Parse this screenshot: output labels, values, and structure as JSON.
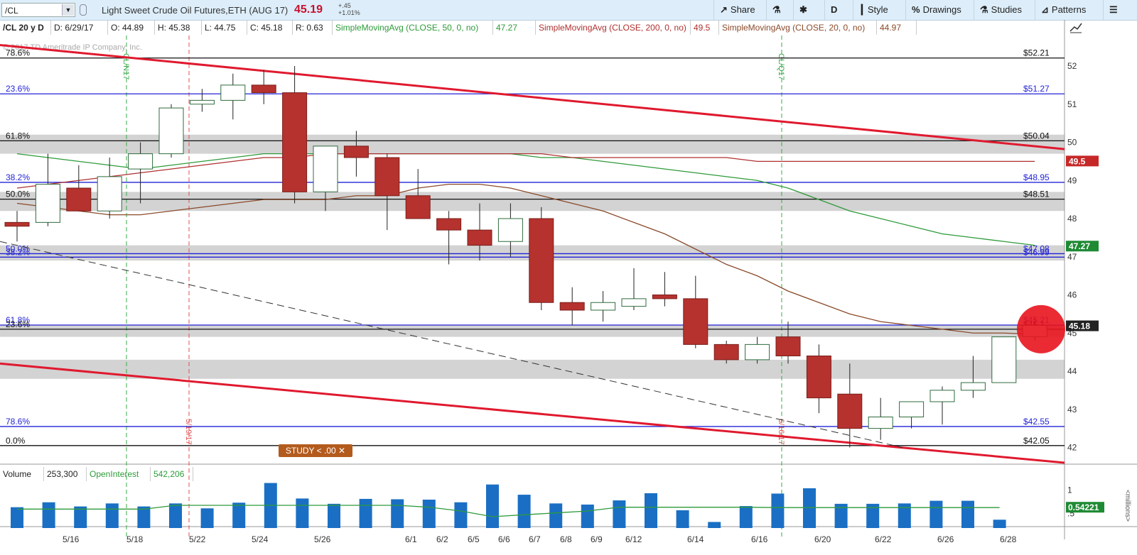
{
  "toolbar": {
    "symbol": "/CL",
    "title": "Light Sweet Crude Oil Futures,ETH (AUG 17)",
    "last": "45.19",
    "change": "+.45",
    "change_pct": "+1.01%",
    "buttons": {
      "share": "Share",
      "aggregation": "D",
      "style": "Style",
      "drawings": "Drawings",
      "studies": "Studies",
      "patterns": "Patterns"
    }
  },
  "info": {
    "symbol_period": "/CL 20 y D",
    "date": "D: 6/29/17",
    "open": "O: 44.89",
    "high": "H: 45.38",
    "low": "L: 44.75",
    "close": "C: 45.18",
    "range": "R: 0.63",
    "sma50_label": "SimpleMovingAvg (CLOSE, 50, 0, no)",
    "sma50_value": "47.27",
    "sma200_label": "SimpleMovingAvg (CLOSE, 200, 0, no)",
    "sma200_value": "49.5",
    "sma20_label": "SimpleMovingAvg (CLOSE, 20, 0, no)",
    "sma20_value": "44.97"
  },
  "volume_header": {
    "volume_label": "Volume",
    "volume_value": "253,300",
    "oi_label": "OpenInterest",
    "oi_value": "542,206"
  },
  "study_badge": "STUDY < .00 ✕",
  "colors": {
    "up_border": "#2f6b3d",
    "down_fill": "#b5322e",
    "sma50": "#2e9a3a",
    "sma200": "#b03030",
    "sma20": "#8a4a2a",
    "trend": "#e0192e",
    "fib_line": "#2323d8",
    "volume_bar": "#1a6fc4",
    "current_price_flag": "#222",
    "accent_red": "#c8102e"
  },
  "chart_data": {
    "type": "candlestick",
    "title": "Light Sweet Crude Oil Futures,ETH (AUG 17)",
    "ylim": [
      41.6,
      52.8
    ],
    "price_ticks": [
      42,
      43,
      44,
      45,
      46,
      47,
      48,
      49,
      50,
      51,
      52
    ],
    "x_tick_labels": [
      "5/16",
      "5/18",
      "5/22",
      "5/24",
      "5/26",
      "6/1",
      "6/2",
      "6/5",
      "6/6",
      "6/7",
      "6/8",
      "6/9",
      "6/12",
      "6/14",
      "6/16",
      "6/20",
      "6/22",
      "6/26",
      "6/28"
    ],
    "candles": [
      {
        "o": 47.9,
        "h": 48.2,
        "l": 47.4,
        "c": 47.8
      },
      {
        "o": 47.9,
        "h": 49.7,
        "l": 47.8,
        "c": 48.9
      },
      {
        "o": 48.8,
        "h": 49.4,
        "l": 48.2,
        "c": 48.2
      },
      {
        "o": 48.2,
        "h": 49.6,
        "l": 48.0,
        "c": 49.1
      },
      {
        "o": 49.3,
        "h": 50.0,
        "l": 48.4,
        "c": 49.7
      },
      {
        "o": 49.7,
        "h": 51.0,
        "l": 49.6,
        "c": 50.9
      },
      {
        "o": 51.0,
        "h": 51.4,
        "l": 50.8,
        "c": 51.1
      },
      {
        "o": 51.1,
        "h": 51.8,
        "l": 50.6,
        "c": 51.5
      },
      {
        "o": 51.5,
        "h": 51.9,
        "l": 51.0,
        "c": 51.3
      },
      {
        "o": 51.3,
        "h": 52.0,
        "l": 48.4,
        "c": 48.7
      },
      {
        "o": 48.7,
        "h": 49.9,
        "l": 48.2,
        "c": 49.9
      },
      {
        "o": 49.9,
        "h": 50.3,
        "l": 49.1,
        "c": 49.6
      },
      {
        "o": 49.6,
        "h": 49.7,
        "l": 47.7,
        "c": 48.6
      },
      {
        "o": 48.6,
        "h": 49.3,
        "l": 48.0,
        "c": 48.0
      },
      {
        "o": 48.0,
        "h": 48.2,
        "l": 46.8,
        "c": 47.7
      },
      {
        "o": 47.7,
        "h": 48.4,
        "l": 46.9,
        "c": 47.3
      },
      {
        "o": 47.4,
        "h": 48.4,
        "l": 47.0,
        "c": 48.0
      },
      {
        "o": 48.0,
        "h": 48.3,
        "l": 45.6,
        "c": 45.8
      },
      {
        "o": 45.8,
        "h": 46.2,
        "l": 45.2,
        "c": 45.6
      },
      {
        "o": 45.6,
        "h": 46.1,
        "l": 45.3,
        "c": 45.8
      },
      {
        "o": 45.7,
        "h": 46.7,
        "l": 45.6,
        "c": 45.9
      },
      {
        "o": 46.0,
        "h": 46.6,
        "l": 45.7,
        "c": 45.9
      },
      {
        "o": 45.9,
        "h": 46.5,
        "l": 44.6,
        "c": 44.7
      },
      {
        "o": 44.7,
        "h": 44.8,
        "l": 44.2,
        "c": 44.3
      },
      {
        "o": 44.3,
        "h": 44.9,
        "l": 44.2,
        "c": 44.7
      },
      {
        "o": 44.9,
        "h": 45.3,
        "l": 44.2,
        "c": 44.4
      },
      {
        "o": 44.4,
        "h": 44.7,
        "l": 42.9,
        "c": 43.3
      },
      {
        "o": 43.4,
        "h": 44.2,
        "l": 42.0,
        "c": 42.5
      },
      {
        "o": 42.5,
        "h": 43.3,
        "l": 42.2,
        "c": 42.8
      },
      {
        "o": 42.8,
        "h": 43.2,
        "l": 42.5,
        "c": 43.2
      },
      {
        "o": 43.2,
        "h": 43.6,
        "l": 42.6,
        "c": 43.5
      },
      {
        "o": 43.5,
        "h": 44.4,
        "l": 43.3,
        "c": 43.7
      },
      {
        "o": 43.7,
        "h": 44.9,
        "l": 43.7,
        "c": 44.9
      },
      {
        "o": 44.9,
        "h": 45.4,
        "l": 44.8,
        "c": 45.2
      }
    ],
    "sma50": [
      49.7,
      49.6,
      49.5,
      49.4,
      49.3,
      49.4,
      49.5,
      49.6,
      49.7,
      49.7,
      49.7,
      49.7,
      49.7,
      49.7,
      49.7,
      49.7,
      49.7,
      49.6,
      49.6,
      49.5,
      49.4,
      49.3,
      49.2,
      49.1,
      49.0,
      48.8,
      48.5,
      48.2,
      48.0,
      47.8,
      47.6,
      47.5,
      47.4,
      47.3
    ],
    "sma200": [
      48.8,
      48.9,
      49.0,
      49.1,
      49.2,
      49.3,
      49.4,
      49.5,
      49.6,
      49.6,
      49.7,
      49.7,
      49.7,
      49.7,
      49.7,
      49.7,
      49.7,
      49.7,
      49.6,
      49.6,
      49.6,
      49.6,
      49.6,
      49.6,
      49.5,
      49.5,
      49.5,
      49.5,
      49.5,
      49.5,
      49.5,
      49.5,
      49.5,
      49.5
    ],
    "sma20": [
      48.4,
      48.3,
      48.2,
      48.1,
      48.1,
      48.2,
      48.3,
      48.4,
      48.5,
      48.5,
      48.5,
      48.6,
      48.6,
      48.8,
      48.9,
      48.9,
      48.8,
      48.6,
      48.4,
      48.2,
      47.9,
      47.6,
      47.2,
      46.8,
      46.5,
      46.1,
      45.8,
      45.5,
      45.3,
      45.2,
      45.1,
      45.0,
      45.0,
      44.97
    ],
    "horizontal_levels": [
      {
        "label": "23.6%",
        "price_label": "$51.27",
        "value": 51.27,
        "color": "blue"
      },
      {
        "label": "61.8%",
        "price_label": "$50.04",
        "value": 50.04,
        "color": "black"
      },
      {
        "label": "38.2%",
        "price_label": "$48.95",
        "value": 48.95,
        "color": "blue"
      },
      {
        "label": "50.0%",
        "price_label": "$48.51",
        "value": 48.51,
        "color": "black"
      },
      {
        "label": "50.0%",
        "price_label": "$47.08",
        "value": 47.08,
        "color": "blue"
      },
      {
        "label": "38.2%",
        "price_label": "$46.99",
        "value": 46.99,
        "color": "blue"
      },
      {
        "label": "61.8%",
        "price_label": "$45.21",
        "value": 45.21,
        "color": "blue"
      },
      {
        "label": "23.6%",
        "price_label": "$45.1",
        "value": 45.1,
        "color": "black"
      },
      {
        "label": "78.6%",
        "price_label": "$42.55",
        "value": 42.55,
        "color": "blue"
      },
      {
        "label": "0.0%",
        "price_label": "$42.05",
        "value": 42.05,
        "color": "black"
      },
      {
        "label": "78.6%",
        "price_label": "$52.21",
        "value": 52.21,
        "color": "black"
      }
    ],
    "gray_zones": [
      [
        49.7,
        50.2
      ],
      [
        48.2,
        48.7
      ],
      [
        46.9,
        47.3
      ],
      [
        44.9,
        45.2
      ],
      [
        43.8,
        44.3
      ]
    ],
    "current_price": "45.18",
    "sma50_flag": "47.27",
    "sma200_flag": "49.5",
    "vertical_markers": [
      {
        "label": "5/19/17",
        "style": "red-dashed"
      },
      {
        "label": "6/16/17",
        "style": "red-dashed"
      },
      {
        "label": "CL/N17",
        "style": "green-dashed"
      },
      {
        "label": "CL/Q17",
        "style": "green-dashed"
      }
    ],
    "copyright": "© 2017 TD Ameritrade IP Company, Inc.",
    "volume": {
      "values": [
        0.55,
        0.68,
        0.57,
        0.65,
        0.57,
        0.65,
        0.52,
        0.67,
        1.19,
        0.78,
        0.64,
        0.77,
        0.76,
        0.75,
        0.68,
        1.15,
        0.88,
        0.65,
        0.62,
        0.73,
        0.92,
        0.47,
        0.16,
        0.58,
        0.91,
        1.05,
        0.64,
        0.64,
        0.65,
        0.72,
        0.72,
        0.22
      ],
      "oi_line": [
        0.5,
        0.5,
        0.5,
        0.5,
        0.5,
        0.6,
        0.6,
        0.6,
        0.6,
        0.6,
        0.6,
        0.6,
        0.6,
        0.55,
        0.45,
        0.3,
        0.35,
        0.4,
        0.45,
        0.55,
        0.55,
        0.55,
        0.55,
        0.55,
        0.54,
        0.54,
        0.54,
        0.54,
        0.54,
        0.54,
        0.54,
        0.54
      ],
      "ticks": [
        "1",
        ".5"
      ],
      "unit_label": "<millions>",
      "flag": "0.54221"
    }
  }
}
